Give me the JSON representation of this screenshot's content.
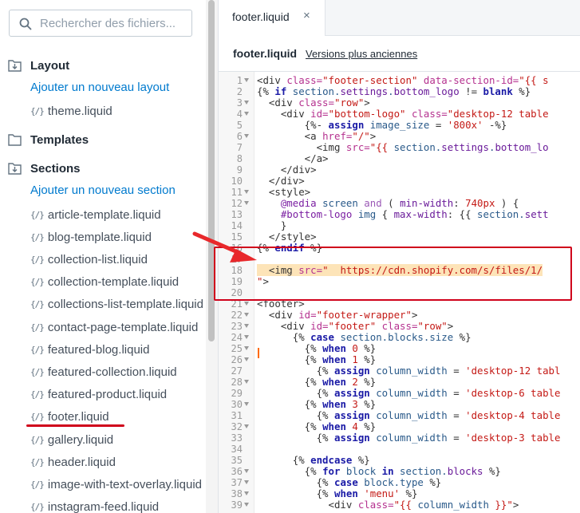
{
  "search": {
    "placeholder": "Rechercher des fichiers..."
  },
  "sidebar": {
    "layout": {
      "title": "Layout",
      "add": "Ajouter un nouveau layout",
      "files": [
        "theme.liquid"
      ]
    },
    "templates": {
      "title": "Templates"
    },
    "sections": {
      "title": "Sections",
      "add": "Ajouter un nouveau section",
      "files": [
        "article-template.liquid",
        "blog-template.liquid",
        "collection-list.liquid",
        "collection-template.liquid",
        "collections-list-template.liquid",
        "contact-page-template.liquid",
        "featured-blog.liquid",
        "featured-collection.liquid",
        "featured-product.liquid",
        "footer.liquid",
        "gallery.liquid",
        "header.liquid",
        "image-with-text-overlay.liquid",
        "instagram-feed.liquid"
      ]
    },
    "liquid_icon": "{/}"
  },
  "tab": {
    "name": "footer.liquid",
    "close": "×"
  },
  "file_header": {
    "name": "footer.liquid",
    "older_versions": "Versions plus anciennes"
  },
  "colors": {
    "link": "#007ace",
    "highlight": "#fde4b8",
    "annotation": "#d0021b"
  },
  "code_lines": [
    {
      "n": "1",
      "fold": true,
      "t": [
        [
          "t-tag",
          "<div "
        ],
        [
          "t-attr",
          "class="
        ],
        [
          "t-str",
          "\"footer-section\""
        ],
        [
          "t-attr",
          " data-section-id="
        ],
        [
          "t-str",
          "\"{{ s"
        ]
      ]
    },
    {
      "n": "2",
      "fold": false,
      "t": [
        [
          "t-liq",
          "{% "
        ],
        [
          "t-kw",
          "if"
        ],
        [
          "t-var",
          " section."
        ],
        [
          "t-prop",
          "settings"
        ],
        [
          "t-var",
          "."
        ],
        [
          "t-prop",
          "bottom_logo"
        ],
        [
          "t-liq",
          " != "
        ],
        [
          "t-kw",
          "blank"
        ],
        [
          "t-liq",
          " %}"
        ]
      ]
    },
    {
      "n": "3",
      "fold": true,
      "t": [
        [
          "t-tag",
          "  <div "
        ],
        [
          "t-attr",
          "class="
        ],
        [
          "t-str",
          "\"row\""
        ],
        [
          "t-tag",
          ">"
        ]
      ]
    },
    {
      "n": "4",
      "fold": true,
      "t": [
        [
          "t-tag",
          "    <div "
        ],
        [
          "t-attr",
          "id="
        ],
        [
          "t-str",
          "\"bottom-logo\""
        ],
        [
          "t-attr",
          " class="
        ],
        [
          "t-str",
          "\"desktop-12 table"
        ]
      ]
    },
    {
      "n": "5",
      "fold": false,
      "t": [
        [
          "t-liq",
          "        {%- "
        ],
        [
          "t-kw",
          "assign"
        ],
        [
          "t-var",
          " image_size"
        ],
        [
          "t-liq",
          " = "
        ],
        [
          "t-str",
          "'800x'"
        ],
        [
          "t-liq",
          " -%}"
        ]
      ]
    },
    {
      "n": "6",
      "fold": true,
      "t": [
        [
          "t-tag",
          "        <a "
        ],
        [
          "t-attr",
          "href="
        ],
        [
          "t-str",
          "\"/\""
        ],
        [
          "t-tag",
          ">"
        ]
      ]
    },
    {
      "n": "7",
      "fold": false,
      "t": [
        [
          "t-tag",
          "          <img "
        ],
        [
          "t-attr",
          "src="
        ],
        [
          "t-str",
          "\"{{ "
        ],
        [
          "t-var",
          "section."
        ],
        [
          "t-prop",
          "settings"
        ],
        [
          "t-var",
          "."
        ],
        [
          "t-prop",
          "bottom_lo"
        ]
      ]
    },
    {
      "n": "8",
      "fold": false,
      "t": [
        [
          "t-tag",
          "        </a>"
        ]
      ]
    },
    {
      "n": "9",
      "fold": false,
      "t": [
        [
          "t-tag",
          "    </div>"
        ]
      ]
    },
    {
      "n": "10",
      "fold": false,
      "t": [
        [
          "t-tag",
          "  </div>"
        ]
      ]
    },
    {
      "n": "11",
      "fold": true,
      "t": [
        [
          "t-tag",
          "  <style>"
        ]
      ]
    },
    {
      "n": "12",
      "fold": true,
      "t": [
        [
          "t-sel",
          "    @media"
        ],
        [
          "t-var",
          " screen "
        ],
        [
          "t-op",
          "and"
        ],
        [
          "t-liq",
          " ( "
        ],
        [
          "t-prop",
          "min-width"
        ],
        [
          "t-liq",
          ": "
        ],
        [
          "t-str",
          "740px"
        ],
        [
          "t-liq",
          " ) {"
        ]
      ]
    },
    {
      "n": "13",
      "fold": false,
      "t": [
        [
          "t-sel",
          "    #bottom-logo"
        ],
        [
          "t-var",
          " img"
        ],
        [
          "t-liq",
          " { "
        ],
        [
          "t-prop",
          "max-width"
        ],
        [
          "t-liq",
          ": {{ "
        ],
        [
          "t-var",
          "section."
        ],
        [
          "t-prop",
          "sett"
        ]
      ]
    },
    {
      "n": "14",
      "fold": false,
      "t": [
        [
          "t-liq",
          "    }"
        ]
      ]
    },
    {
      "n": "15",
      "fold": false,
      "t": [
        [
          "t-tag",
          "  </style>"
        ]
      ]
    },
    {
      "n": "16",
      "fold": false,
      "t": [
        [
          "t-liq",
          "{% "
        ],
        [
          "t-kw",
          "endif"
        ],
        [
          "t-liq",
          " %}"
        ]
      ]
    },
    {
      "n": "17",
      "fold": false,
      "t": [
        [
          "t-liq",
          ""
        ]
      ]
    },
    {
      "n": "18",
      "fold": false,
      "hl": true,
      "t": [
        [
          "t-tag",
          "  <img "
        ],
        [
          "t-attr",
          "src="
        ],
        [
          "t-str",
          "\"  https://cdn.shopify.com/s/files/1/"
        ]
      ]
    },
    {
      "n": "19",
      "fold": false,
      "t": [
        [
          "t-str",
          "\""
        ],
        [
          "t-tag",
          ">"
        ]
      ]
    },
    {
      "n": "20",
      "fold": false,
      "t": [
        [
          "t-liq",
          ""
        ]
      ]
    },
    {
      "n": "21",
      "fold": true,
      "t": [
        [
          "t-tag",
          "<footer>"
        ]
      ]
    },
    {
      "n": "22",
      "fold": true,
      "t": [
        [
          "t-tag",
          "  <div "
        ],
        [
          "t-attr",
          "id="
        ],
        [
          "t-str",
          "\"footer-wrapper\""
        ],
        [
          "t-tag",
          ">"
        ]
      ]
    },
    {
      "n": "23",
      "fold": true,
      "t": [
        [
          "t-tag",
          "    <div "
        ],
        [
          "t-attr",
          "id="
        ],
        [
          "t-str",
          "\"footer\""
        ],
        [
          "t-attr",
          " class="
        ],
        [
          "t-str",
          "\"row\""
        ],
        [
          "t-tag",
          ">"
        ]
      ]
    },
    {
      "n": "24",
      "fold": true,
      "t": [
        [
          "t-liq",
          "      {% "
        ],
        [
          "t-kw",
          "case"
        ],
        [
          "t-var",
          " section.blocks.size"
        ],
        [
          "t-liq",
          " %}"
        ]
      ]
    },
    {
      "n": "25",
      "fold": true,
      "t": [
        [
          "t-liq",
          "        {% "
        ],
        [
          "t-kw",
          "when"
        ],
        [
          "t-str",
          " 0"
        ],
        [
          "t-liq",
          " %}"
        ]
      ]
    },
    {
      "n": "26",
      "fold": true,
      "t": [
        [
          "t-liq",
          "        {% "
        ],
        [
          "t-kw",
          "when"
        ],
        [
          "t-str",
          " 1"
        ],
        [
          "t-liq",
          " %}"
        ]
      ]
    },
    {
      "n": "27",
      "fold": false,
      "t": [
        [
          "t-liq",
          "          {% "
        ],
        [
          "t-kw",
          "assign"
        ],
        [
          "t-var",
          " column_width"
        ],
        [
          "t-liq",
          " = "
        ],
        [
          "t-str",
          "'desktop-12 tabl"
        ]
      ]
    },
    {
      "n": "28",
      "fold": true,
      "t": [
        [
          "t-liq",
          "        {% "
        ],
        [
          "t-kw",
          "when"
        ],
        [
          "t-str",
          " 2"
        ],
        [
          "t-liq",
          " %}"
        ]
      ]
    },
    {
      "n": "29",
      "fold": false,
      "t": [
        [
          "t-liq",
          "          {% "
        ],
        [
          "t-kw",
          "assign"
        ],
        [
          "t-var",
          " column_width"
        ],
        [
          "t-liq",
          " = "
        ],
        [
          "t-str",
          "'desktop-6 table"
        ]
      ]
    },
    {
      "n": "30",
      "fold": true,
      "t": [
        [
          "t-liq",
          "        {% "
        ],
        [
          "t-kw",
          "when"
        ],
        [
          "t-str",
          " 3"
        ],
        [
          "t-liq",
          " %}"
        ]
      ]
    },
    {
      "n": "31",
      "fold": false,
      "t": [
        [
          "t-liq",
          "          {% "
        ],
        [
          "t-kw",
          "assign"
        ],
        [
          "t-var",
          " column_width"
        ],
        [
          "t-liq",
          " = "
        ],
        [
          "t-str",
          "'desktop-4 table"
        ]
      ]
    },
    {
      "n": "32",
      "fold": true,
      "t": [
        [
          "t-liq",
          "        {% "
        ],
        [
          "t-kw",
          "when"
        ],
        [
          "t-str",
          " 4"
        ],
        [
          "t-liq",
          " %}"
        ]
      ]
    },
    {
      "n": "33",
      "fold": false,
      "t": [
        [
          "t-liq",
          "          {% "
        ],
        [
          "t-kw",
          "assign"
        ],
        [
          "t-var",
          " column_width"
        ],
        [
          "t-liq",
          " = "
        ],
        [
          "t-str",
          "'desktop-3 table"
        ]
      ]
    },
    {
      "n": "34",
      "fold": false,
      "t": [
        [
          "t-liq",
          ""
        ]
      ]
    },
    {
      "n": "35",
      "fold": false,
      "t": [
        [
          "t-liq",
          "      {% "
        ],
        [
          "t-kw",
          "endcase"
        ],
        [
          "t-liq",
          " %}"
        ]
      ]
    },
    {
      "n": "36",
      "fold": true,
      "t": [
        [
          "t-liq",
          "        {% "
        ],
        [
          "t-kw",
          "for"
        ],
        [
          "t-var",
          " block "
        ],
        [
          "t-kw",
          "in"
        ],
        [
          "t-var",
          " section."
        ],
        [
          "t-prop",
          "blocks"
        ],
        [
          "t-liq",
          " %}"
        ]
      ]
    },
    {
      "n": "37",
      "fold": true,
      "t": [
        [
          "t-liq",
          "          {% "
        ],
        [
          "t-kw",
          "case"
        ],
        [
          "t-var",
          " block.type"
        ],
        [
          "t-liq",
          " %}"
        ]
      ]
    },
    {
      "n": "38",
      "fold": true,
      "t": [
        [
          "t-liq",
          "          {% "
        ],
        [
          "t-kw",
          "when"
        ],
        [
          "t-str",
          " 'menu'"
        ],
        [
          "t-liq",
          " %}"
        ]
      ]
    },
    {
      "n": "39",
      "fold": true,
      "t": [
        [
          "t-tag",
          "            <div "
        ],
        [
          "t-attr",
          "class="
        ],
        [
          "t-str",
          "\"{{ "
        ],
        [
          "t-var",
          "column_width"
        ],
        [
          "t-str",
          " }}\""
        ],
        [
          "t-tag",
          ">"
        ]
      ]
    }
  ]
}
